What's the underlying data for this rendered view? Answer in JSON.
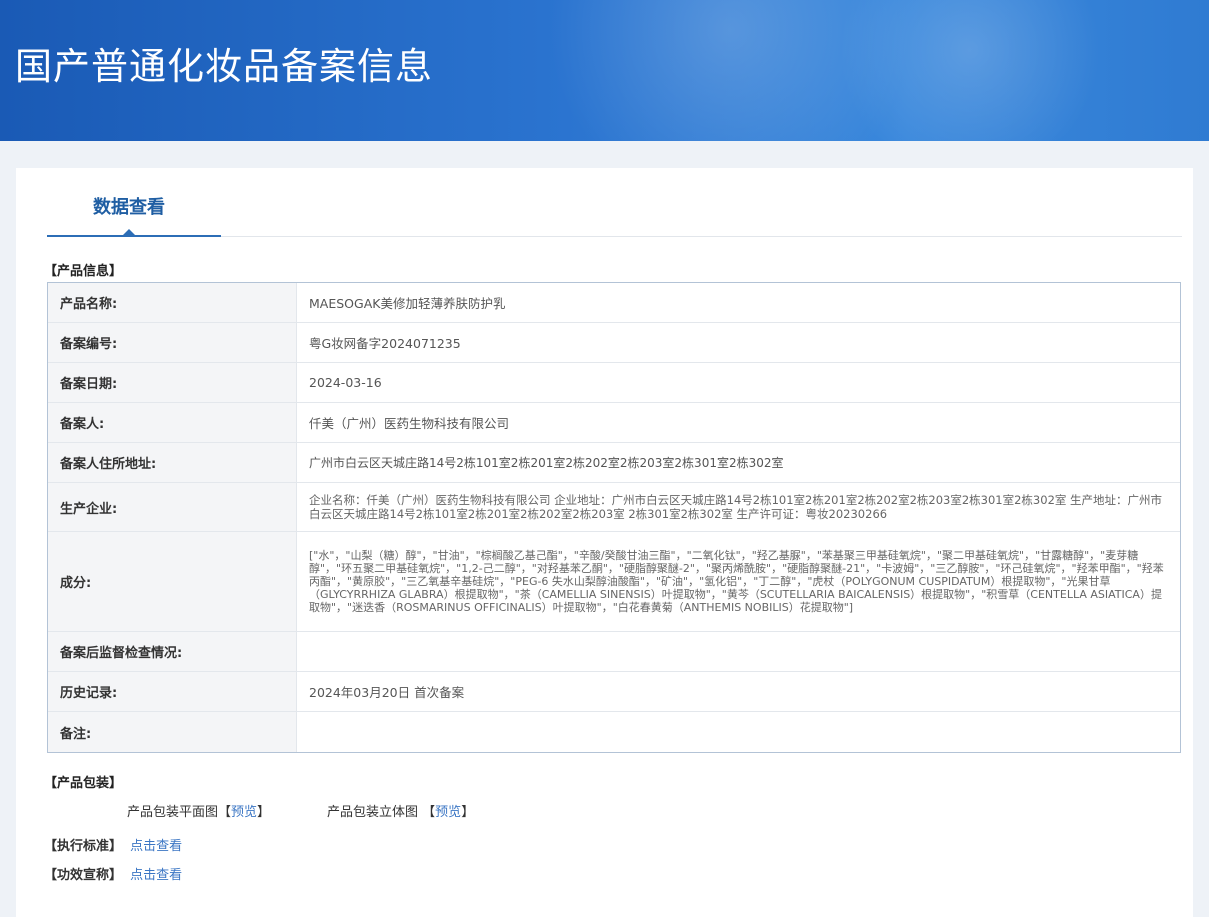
{
  "header": {
    "title": "国产普通化妆品备案信息"
  },
  "tab": {
    "label": "数据查看"
  },
  "product_info": {
    "section_label": "【产品信息】",
    "rows": [
      {
        "label": "产品名称:",
        "value": "MAESOGAK美修加轻薄养肤防护乳"
      },
      {
        "label": "备案编号:",
        "value": "粤G妆网备字2024071235"
      },
      {
        "label": "备案日期:",
        "value": "2024-03-16"
      },
      {
        "label": "备案人:",
        "value": "仟美（广州）医药生物科技有限公司"
      },
      {
        "label": "备案人住所地址:",
        "value": "广州市白云区天城庄路14号2栋101室2栋201室2栋202室2栋203室2栋301室2栋302室"
      },
      {
        "label": "生产企业:",
        "value": "企业名称：仟美（广州）医药生物科技有限公司 企业地址：广州市白云区天城庄路14号2栋101室2栋201室2栋202室2栋203室2栋301室2栋302室 生产地址：广州市白云区天城庄路14号2栋101室2栋201室2栋202室2栋203室 2栋301室2栋302室 生产许可证：粤妆20230266"
      },
      {
        "label": "成分:",
        "value": "[\"水\"，\"山梨（糖）醇\"，\"甘油\"，\"棕榈酸乙基己酯\"，\"辛酸/癸酸甘油三酯\"，\"二氧化钛\"，\"羟乙基脲\"，\"苯基聚三甲基硅氧烷\"，\"聚二甲基硅氧烷\"，\"甘露糖醇\"，\"麦芽糖醇\"，\"环五聚二甲基硅氧烷\"，\"1,2-己二醇\"，\"对羟基苯乙酮\"，\"硬脂醇聚醚-2\"，\"聚丙烯酰胺\"，\"硬脂醇聚醚-21\"，\"卡波姆\"，\"三乙醇胺\"，\"环己硅氧烷\"，\"羟苯甲酯\"，\"羟苯丙酯\"，\"黄原胶\"，\"三乙氧基辛基硅烷\"，\"PEG-6 失水山梨醇油酸酯\"，\"矿油\"，\"氢化铝\"，\"丁二醇\"，\"虎杖（POLYGONUM CUSPIDATUM）根提取物\"，\"光果甘草（GLYCYRRHIZA GLABRA）根提取物\"，\"茶（CAMELLIA SINENSIS）叶提取物\"，\"黄芩（SCUTELLARIA BAICALENSIS）根提取物\"，\"积雪草（CENTELLA ASIATICA）提取物\"，\"迷迭香（ROSMARINUS OFFICINALIS）叶提取物\"，\"白花春黄菊（ANTHEMIS NOBILIS）花提取物\"]"
      },
      {
        "label": "备案后监督检查情况:",
        "value": ""
      },
      {
        "label": "历史记录:",
        "value": "2024年03月20日 首次备案"
      },
      {
        "label": "备注:",
        "value": ""
      }
    ]
  },
  "packaging": {
    "section_label": "【产品包装】",
    "flat_label": "产品包装平面图",
    "flat_link": "预览",
    "stereo_label": "产品包装立体图",
    "stereo_link": "预览",
    "bracket_open": "【",
    "bracket_close": "】"
  },
  "standard": {
    "section_label": "【执行标准】",
    "link": "点击查看"
  },
  "efficacy": {
    "section_label": "【功效宣称】",
    "link": "点击查看"
  },
  "colors": {
    "banner": "#2a73cf",
    "tab_accent": "#1f5ea3",
    "link": "#3b76c4",
    "table_border": "#b3c3d6",
    "label_bg": "#f4f5f7"
  }
}
